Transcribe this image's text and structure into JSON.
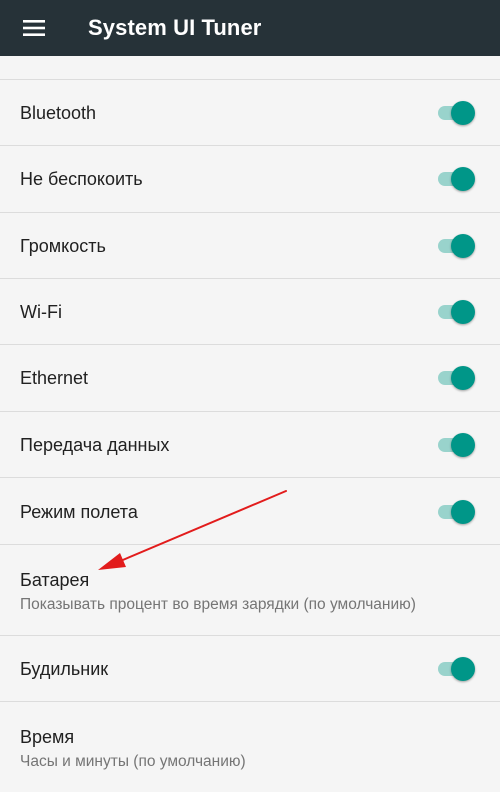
{
  "app_bar": {
    "title": "System UI Tuner",
    "menu_icon": "hamburger-menu-icon",
    "background": "#263238"
  },
  "accent_color": "#009688",
  "settings": [
    {
      "title": "Bluetooth",
      "enabled": true
    },
    {
      "title": "Не беспокоить",
      "enabled": true
    },
    {
      "title": "Громкость",
      "enabled": true
    },
    {
      "title": "Wi-Fi",
      "enabled": true
    },
    {
      "title": "Ethernet",
      "enabled": true
    },
    {
      "title": "Передача данных",
      "enabled": true
    },
    {
      "title": "Режим полета",
      "enabled": true
    },
    {
      "title": "Батарея",
      "summary": "Показывать процент во время зарядки (по умолчанию)"
    },
    {
      "title": "Будильник",
      "enabled": true
    },
    {
      "title": "Время",
      "summary": "Часы и минуты (по умолчанию)"
    }
  ],
  "annotation": {
    "type": "red-arrow",
    "color": "#e21c1c",
    "points_to": "Батарея"
  }
}
